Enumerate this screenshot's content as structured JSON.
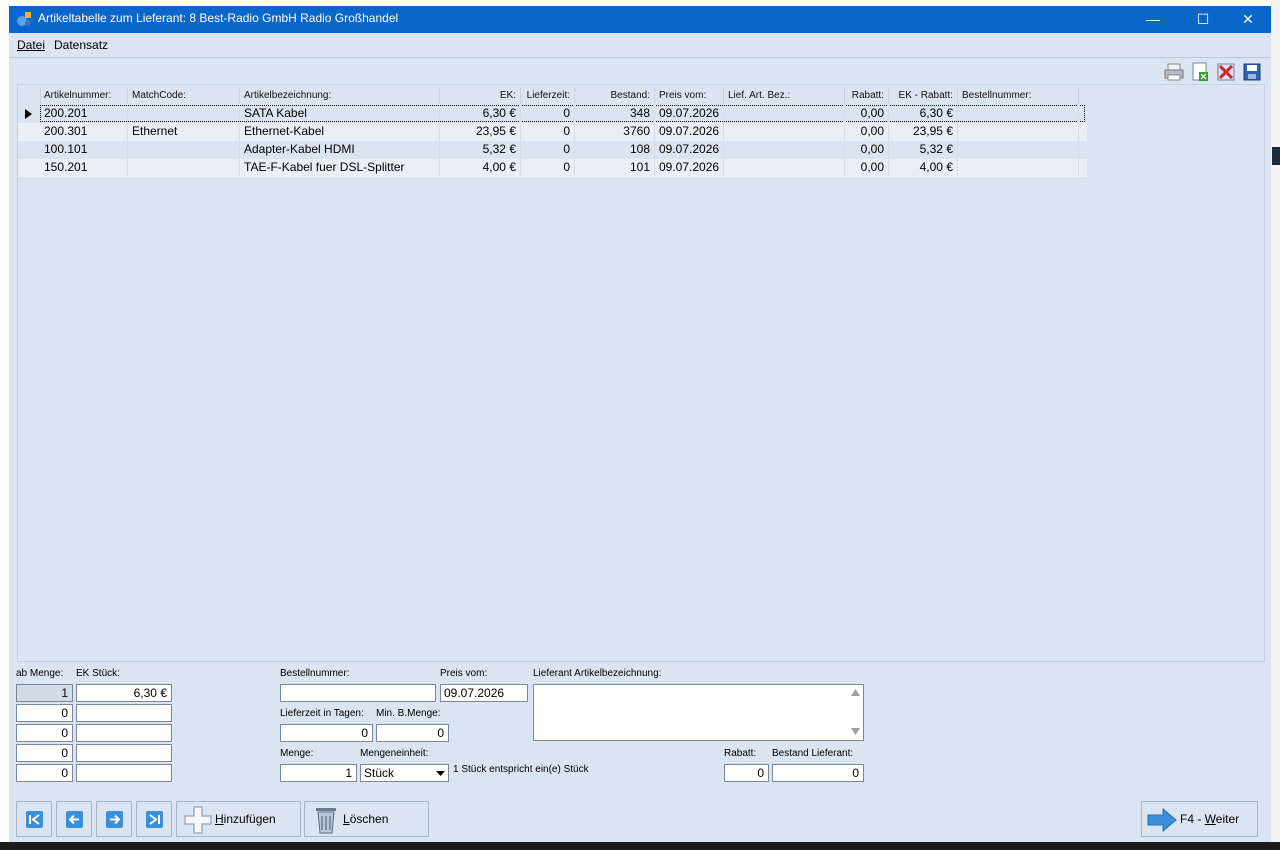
{
  "window": {
    "title": "Artikeltabelle zum Lieferant: 8 Best-Radio GmbH Radio Großhandel",
    "controls": {
      "minimize": "—",
      "maximize": "☐",
      "close": "✕"
    }
  },
  "menu": {
    "items": [
      "Datei",
      "Datensatz"
    ]
  },
  "toolbar": {
    "icons": [
      "print-icon",
      "export-excel-icon",
      "delete-icon",
      "save-icon"
    ]
  },
  "grid": {
    "columns": [
      "Artikelnummer:",
      "MatchCode:",
      "Artikelbezeichnung:",
      "EK:",
      "Lieferzeit:",
      "Bestand:",
      "Preis vom:",
      "Lief. Art. Bez.:",
      "Rabatt:",
      "EK - Rabatt:",
      "Bestellnummer:"
    ],
    "rows": [
      {
        "artikelnummer": "200.201",
        "matchcode": "",
        "bezeichnung": "SATA Kabel",
        "ek": "6,30 €",
        "lieferzeit": "0",
        "bestand": "348",
        "preis_vom": "09.07.2026",
        "lief_art_bez": "",
        "rabatt": "0,00",
        "ek_rabatt": "6,30 €",
        "bestellnummer": ""
      },
      {
        "artikelnummer": "200.301",
        "matchcode": "Ethernet",
        "bezeichnung": "Ethernet-Kabel",
        "ek": "23,95 €",
        "lieferzeit": "0",
        "bestand": "3760",
        "preis_vom": "09.07.2026",
        "lief_art_bez": "",
        "rabatt": "0,00",
        "ek_rabatt": "23,95 €",
        "bestellnummer": ""
      },
      {
        "artikelnummer": "100.101",
        "matchcode": "",
        "bezeichnung": "Adapter-Kabel HDMI",
        "ek": "5,32 €",
        "lieferzeit": "0",
        "bestand": "108",
        "preis_vom": "09.07.2026",
        "lief_art_bez": "",
        "rabatt": "0,00",
        "ek_rabatt": "5,32 €",
        "bestellnummer": ""
      },
      {
        "artikelnummer": "150.201",
        "matchcode": "",
        "bezeichnung": "TAE-F-Kabel fuer DSL-Splitter",
        "ek": "4,00 €",
        "lieferzeit": "0",
        "bestand": "101",
        "preis_vom": "09.07.2026",
        "lief_art_bez": "",
        "rabatt": "0,00",
        "ek_rabatt": "4,00 €",
        "bestellnummer": ""
      }
    ]
  },
  "form": {
    "ab_menge_label": "ab Menge:",
    "ek_stueck_label": "EK Stück:",
    "staffel": [
      {
        "menge": "1",
        "ek": "6,30 €"
      },
      {
        "menge": "0",
        "ek": ""
      },
      {
        "menge": "0",
        "ek": ""
      },
      {
        "menge": "0",
        "ek": ""
      },
      {
        "menge": "0",
        "ek": ""
      }
    ],
    "bestellnummer_label": "Bestellnummer:",
    "bestellnummer": "",
    "preis_vom_label": "Preis vom:",
    "preis_vom": "09.07.2026",
    "lieferant_bez_label": "Lieferant Artikelbezeichnung:",
    "lieferant_bez": "",
    "lieferzeit_label": "Lieferzeit in Tagen:",
    "lieferzeit": "0",
    "min_menge_label": "Min. B.Menge:",
    "min_menge": "0",
    "menge_label": "Menge:",
    "menge": "1",
    "mengeneinheit_label": "Mengeneinheit:",
    "mengeneinheit": "Stück",
    "einheit_hinweis": "1 Stück entspricht ein(e) Stück",
    "rabatt_label": "Rabatt:",
    "rabatt": "0",
    "bestand_lieferant_label": "Bestand Lieferant:",
    "bestand_lieferant": "0"
  },
  "buttons": {
    "hinzufuegen": {
      "accel": "H",
      "rest": "inzufügen"
    },
    "loeschen": {
      "accel": "L",
      "rest": "öschen"
    },
    "weiter": {
      "prefix": "F4 - ",
      "accel": "W",
      "rest": "eiter"
    }
  },
  "colors": {
    "titlebar": "#0a66c8",
    "window_bg": "#dbe5f1",
    "row_alt": "#e9eff7"
  }
}
